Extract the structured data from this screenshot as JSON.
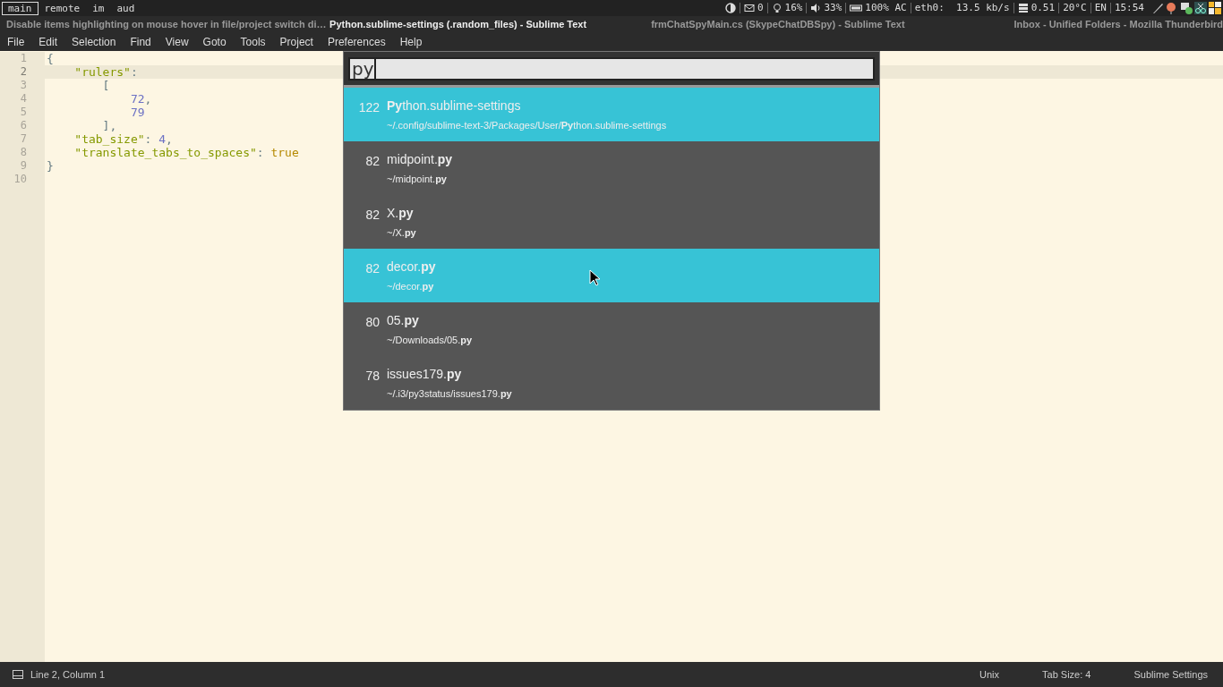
{
  "workspaces": [
    {
      "label": "main",
      "selected": true
    },
    {
      "label": "remote",
      "selected": false
    },
    {
      "label": "im",
      "selected": false
    },
    {
      "label": "aud",
      "selected": false
    }
  ],
  "status_blocks": [
    {
      "kind": "contrast"
    },
    {
      "kind": "mail",
      "text": "0"
    },
    {
      "kind": "bulb",
      "text": "16%"
    },
    {
      "kind": "speaker",
      "text": "33%"
    },
    {
      "kind": "battery",
      "text": "100% AC"
    },
    {
      "kind": "plain",
      "text": "eth0:  13.5 kb/s"
    },
    {
      "kind": "load",
      "text": "0.51"
    },
    {
      "kind": "plain",
      "text": "20°C"
    },
    {
      "kind": "plain",
      "text": "EN"
    },
    {
      "kind": "plain",
      "text": "15:54"
    }
  ],
  "window_titles": [
    {
      "text": "Disable items highlighting on mouse hover in file/project switch di…",
      "focused": false
    },
    {
      "text": "Python.sublime-settings (.random_files) - Sublime Text",
      "focused": true
    },
    {
      "text": "frmChatSpyMain.cs (SkypeChatDBSpy) - Sublime Text",
      "focused": false
    },
    {
      "text": "Inbox - Unified Folders - Mozilla Thunderbird",
      "focused": false
    }
  ],
  "menu": [
    "File",
    "Edit",
    "Selection",
    "Find",
    "View",
    "Goto",
    "Tools",
    "Project",
    "Preferences",
    "Help"
  ],
  "editor": {
    "lines": [
      {
        "number": "1",
        "current": false,
        "tokens": [
          {
            "kind": "punct",
            "text": "{"
          }
        ]
      },
      {
        "number": "2",
        "current": true,
        "tokens": [
          {
            "kind": "string",
            "text": "    \"rulers\""
          },
          {
            "kind": "punct",
            "text": ":"
          }
        ]
      },
      {
        "number": "3",
        "current": false,
        "tokens": [
          {
            "kind": "punct",
            "text": "        ["
          }
        ]
      },
      {
        "number": "4",
        "current": false,
        "tokens": [
          {
            "kind": "number",
            "text": "            72"
          },
          {
            "kind": "punct",
            "text": ","
          }
        ]
      },
      {
        "number": "5",
        "current": false,
        "tokens": [
          {
            "kind": "number",
            "text": "            79"
          }
        ]
      },
      {
        "number": "6",
        "current": false,
        "tokens": [
          {
            "kind": "punct",
            "text": "        ],"
          }
        ]
      },
      {
        "number": "7",
        "current": false,
        "tokens": [
          {
            "kind": "string",
            "text": "    \"tab_size\""
          },
          {
            "kind": "punct",
            "text": ": "
          },
          {
            "kind": "number",
            "text": "4"
          },
          {
            "kind": "punct",
            "text": ","
          }
        ]
      },
      {
        "number": "8",
        "current": false,
        "tokens": [
          {
            "kind": "string",
            "text": "    \"translate_tabs_to_spaces\""
          },
          {
            "kind": "punct",
            "text": ": "
          },
          {
            "kind": "constant",
            "text": "true"
          }
        ]
      },
      {
        "number": "9",
        "current": false,
        "tokens": [
          {
            "kind": "punct",
            "text": "}"
          }
        ]
      },
      {
        "number": "10",
        "current": false
      }
    ]
  },
  "palette": {
    "query": "py",
    "items": [
      {
        "score": "122",
        "title": "**Py**thon.sublime-settings",
        "path": "~/.config/sublime-text-3/Packages/User/**Py**thon.sublime-settings",
        "highlighted": true
      },
      {
        "score": "82",
        "title": "midpoint.**py**",
        "path": "~/midpoint.**py**",
        "highlighted": false
      },
      {
        "score": "82",
        "title": "X.**py**",
        "path": "~/X.**py**",
        "highlighted": false
      },
      {
        "score": "82",
        "title": "decor.**py**",
        "path": "~/decor.**py**",
        "highlighted": true
      },
      {
        "score": "80",
        "title": "05.**py**",
        "path": "~/Downloads/05.**py**",
        "highlighted": false
      },
      {
        "score": "78",
        "title": "issues179.**py**",
        "path": "~/.i3/py3status/issues179.**py**",
        "highlighted": false
      }
    ]
  },
  "status_bar": {
    "position": "Line 2, Column 1",
    "line_endings": "Unix",
    "tab_size": "Tab Size: 4",
    "syntax": "Sublime Settings"
  }
}
